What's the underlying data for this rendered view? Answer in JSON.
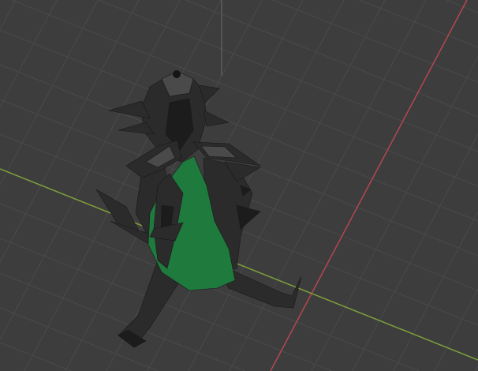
{
  "viewport": {
    "colors": {
      "background": "#3d3d3d",
      "grid": "#4a4a4a",
      "x_axis": "#b5474f",
      "y_axis": "#7fa03a",
      "mesh_dark": "#2b2b2b",
      "mesh_shade": "#1c1c1c",
      "mesh_light": "#4a4a4a",
      "mesh_green": "#1f7a3e"
    }
  }
}
